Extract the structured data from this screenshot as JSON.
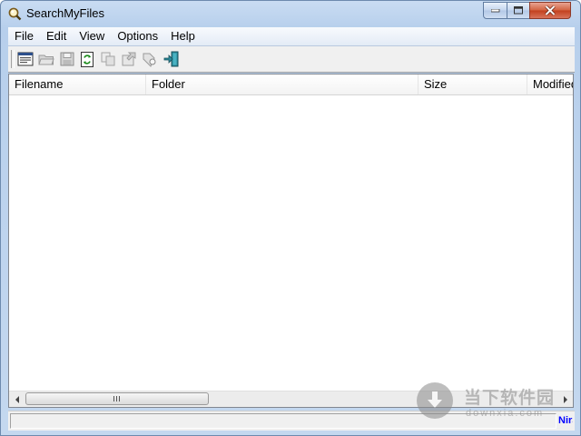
{
  "window": {
    "title": "SearchMyFiles"
  },
  "menu": {
    "items": [
      "File",
      "Edit",
      "View",
      "Options",
      "Help"
    ]
  },
  "toolbar": {
    "buttons": [
      {
        "icon": "search-options-icon",
        "enabled": true
      },
      {
        "icon": "open-folder-icon",
        "enabled": false
      },
      {
        "icon": "save-icon",
        "enabled": false
      },
      {
        "icon": "refresh-icon",
        "enabled": true
      },
      {
        "icon": "copy-icon",
        "enabled": false
      },
      {
        "icon": "properties-icon",
        "enabled": false
      },
      {
        "icon": "find-icon",
        "enabled": false
      },
      {
        "icon": "exit-icon",
        "enabled": true
      }
    ]
  },
  "listview": {
    "columns": [
      "Filename",
      "Folder",
      "Size",
      "Modified"
    ],
    "rows": []
  },
  "statusbar": {
    "link_text": "NirSoft Freeware"
  },
  "watermark": {
    "title": "当下软件园",
    "url": "downxia.com"
  },
  "colors": {
    "title_bar": "#c9dcf2",
    "close_button": "#c2401d",
    "status_link": "#0000ff"
  }
}
